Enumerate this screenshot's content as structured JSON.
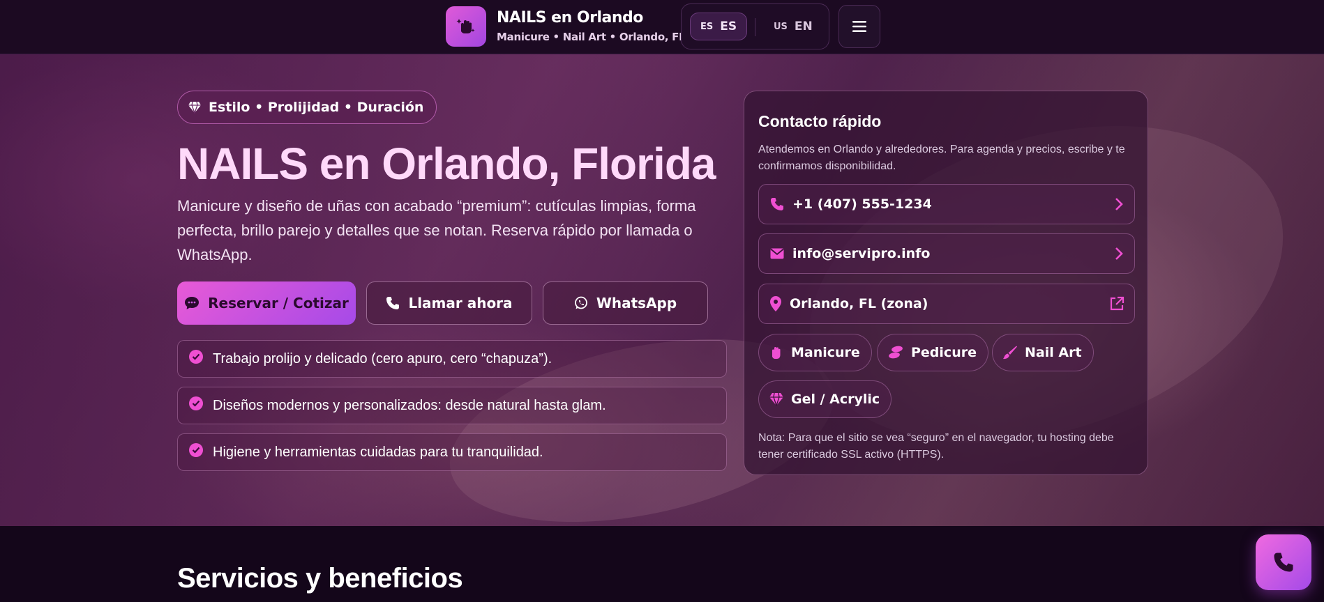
{
  "header": {
    "brand_title": "NAILS en Orlando",
    "brand_subtitle": "Manicure • Nail Art • Orlando, FL",
    "languages": [
      {
        "flag": "ES",
        "code": "ES",
        "active": true
      },
      {
        "flag": "US",
        "code": "EN",
        "active": false
      }
    ],
    "menu_icon": "hamburger-icon"
  },
  "hero": {
    "badge": "Estilo • Prolijidad • Duración",
    "title": "NAILS en Orlando, Florida",
    "description": "Manicure y diseño de uñas con acabado “premium”: cutículas limpias, forma perfecta, brillo parejo y detalles que se notan. Reserva rápido por llamada o WhatsApp.",
    "buttons": {
      "book": "Reservar / Cotizar",
      "call": "Llamar ahora",
      "whatsapp": "WhatsApp"
    },
    "features": [
      "Trabajo prolijo y delicado (cero apuro, cero “chapuza”).",
      "Diseños modernos y personalizados: desde natural hasta glam.",
      "Higiene y herramientas cuidadas para tu tranquilidad."
    ]
  },
  "contact": {
    "title": "Contacto rápido",
    "description": "Atendemos en Orlando y alrededores. Para agenda y precios, escribe y te confirmamos disponibilidad.",
    "phone": "+1 (407) 555-1234",
    "email": "info@servipro.info",
    "location": "Orlando, FL (zona)",
    "services": [
      "Manicure",
      "Pedicure",
      "Nail Art",
      "Gel / Acrylic"
    ],
    "note": "Nota: Para que el sitio se vea “seguro” en el navegador, tu hosting debe tener certificado SSL activo (HTTPS)."
  },
  "section": {
    "title": "Servicios y beneficios"
  },
  "colors": {
    "accent": "#ef4fd2",
    "accent_gradient_start": "#e85ad6",
    "accent_gradient_end": "#a64ae8",
    "background": "#14061a"
  }
}
